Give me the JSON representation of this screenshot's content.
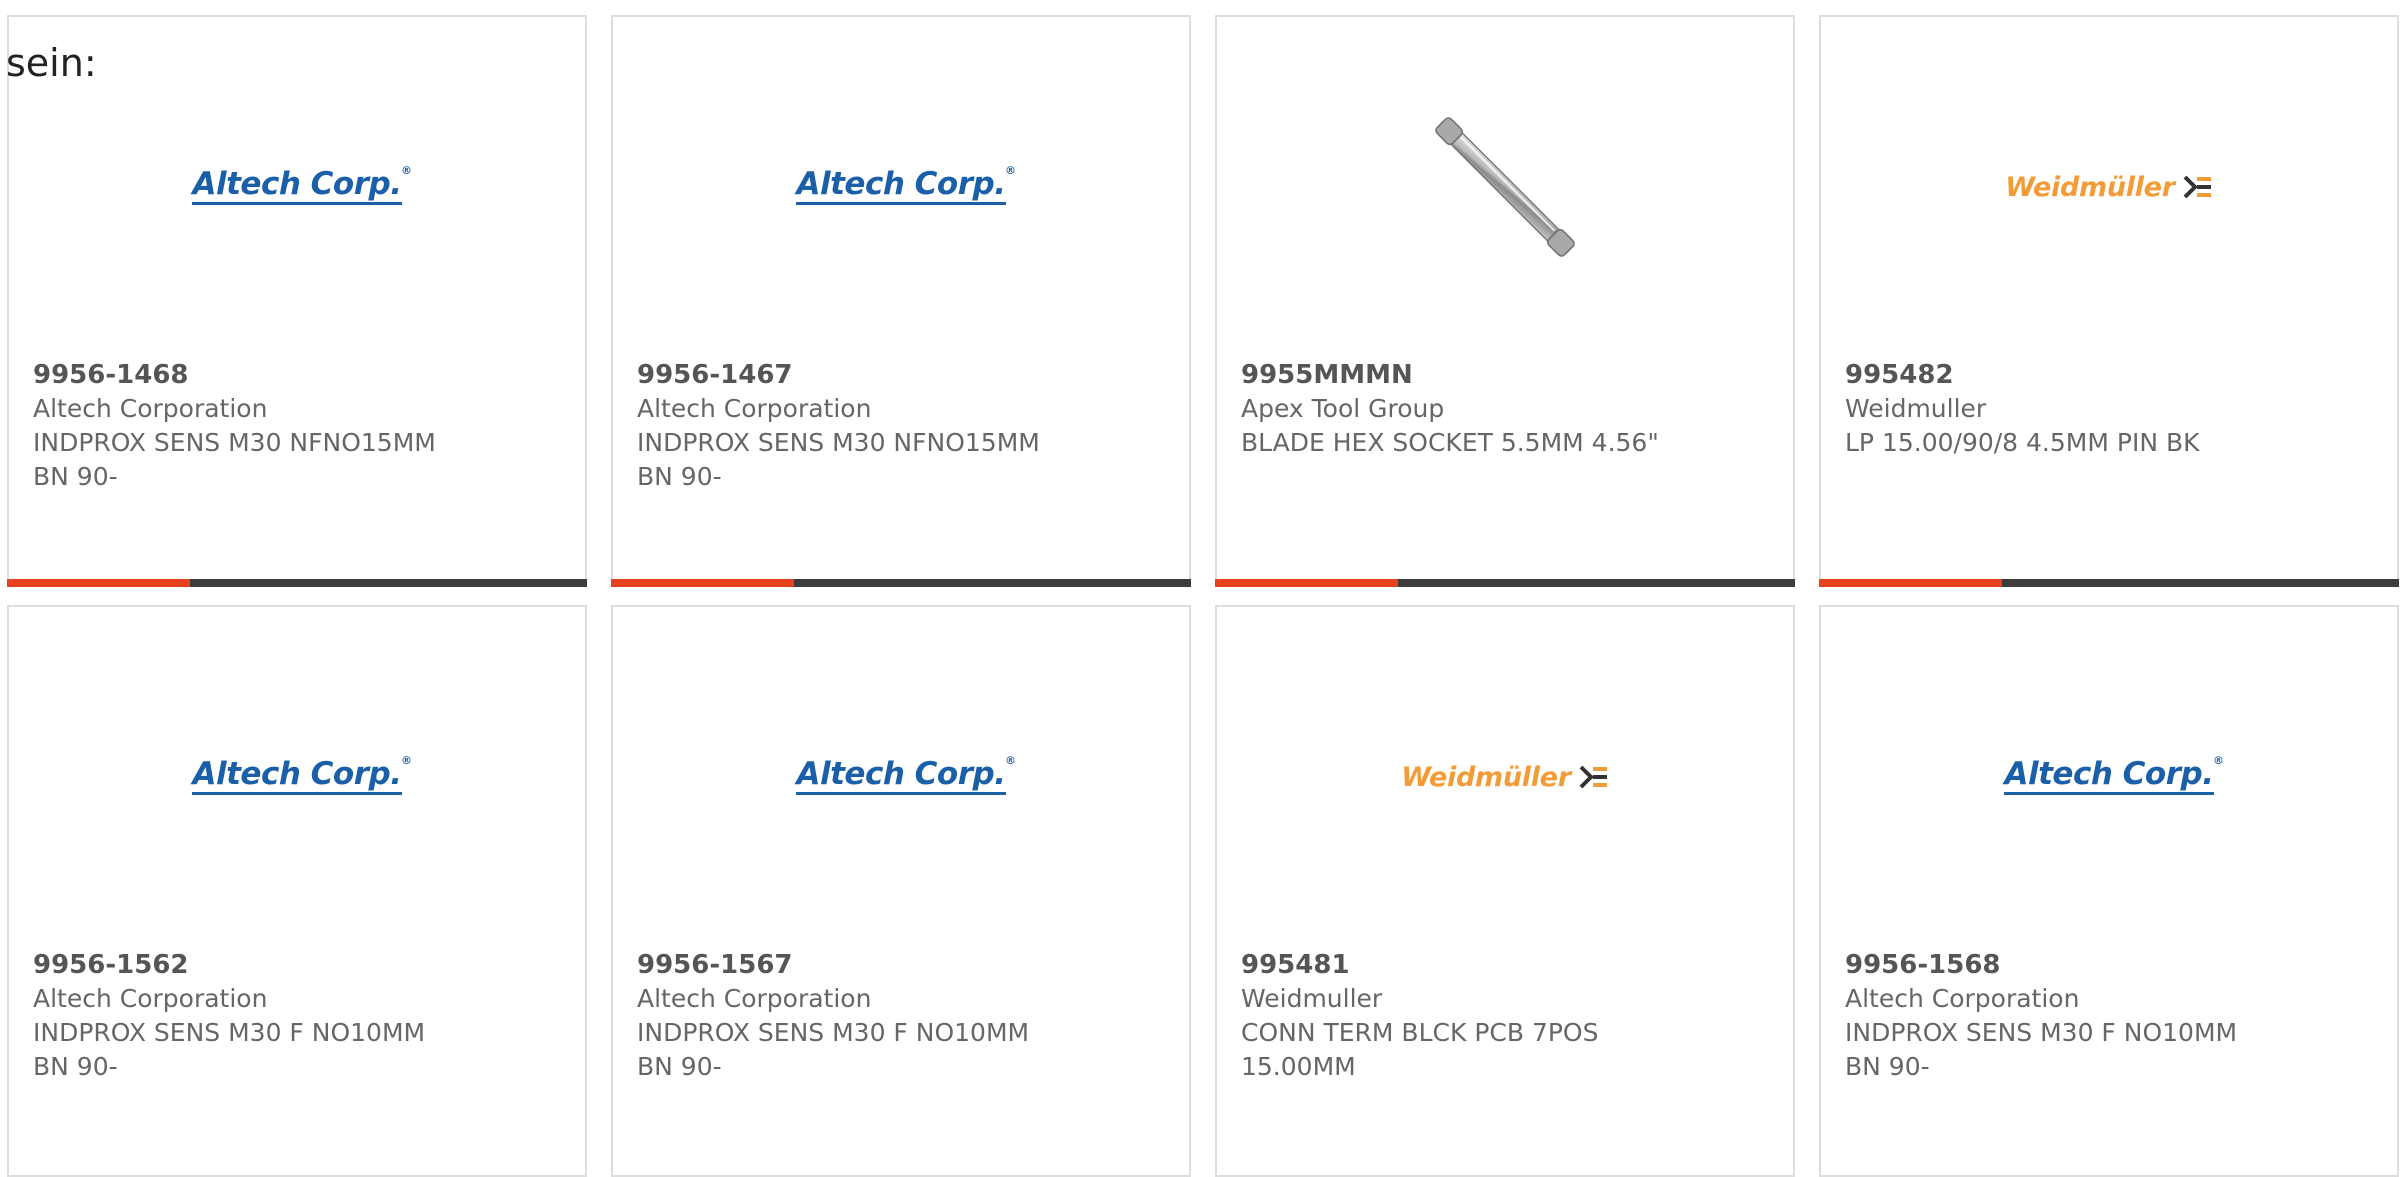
{
  "intro_text": "sein:",
  "colors": {
    "accent": "#e8411f",
    "bar": "#3d3d3d",
    "altech_blue": "#1a5fa8",
    "weidmuller_orange": "#f39c37"
  },
  "products": [
    {
      "part_number": "9956-1468",
      "manufacturer": "Altech Corporation",
      "description": "INDPROX SENS M30 NFNO15MM BN 90-",
      "image": "altech-logo",
      "logo_text": "Altech Corp."
    },
    {
      "part_number": "9956-1467",
      "manufacturer": "Altech Corporation",
      "description": "INDPROX SENS M30 NFNO15MM BN 90-",
      "image": "altech-logo",
      "logo_text": "Altech Corp."
    },
    {
      "part_number": "9955MMMN",
      "manufacturer": "Apex Tool Group",
      "description": "BLADE HEX SOCKET 5.5MM 4.56\"",
      "image": "hex-socket-blade-photo"
    },
    {
      "part_number": "995482",
      "manufacturer": "Weidmuller",
      "description": "LP 15.00/90/8 4.5MM PIN BK",
      "image": "weidmuller-logo",
      "logo_text": "Weidmüller"
    },
    {
      "part_number": "9956-1562",
      "manufacturer": "Altech Corporation",
      "description": "INDPROX SENS M30 F NO10MM BN 90-",
      "image": "altech-logo",
      "logo_text": "Altech Corp."
    },
    {
      "part_number": "9956-1567",
      "manufacturer": "Altech Corporation",
      "description": "INDPROX SENS M30 F NO10MM BN 90-",
      "image": "altech-logo",
      "logo_text": "Altech Corp."
    },
    {
      "part_number": "995481",
      "manufacturer": "Weidmuller",
      "description": "CONN TERM BLCK PCB 7POS 15.00MM",
      "image": "weidmuller-logo",
      "logo_text": "Weidmüller"
    },
    {
      "part_number": "9956-1568",
      "manufacturer": "Altech Corporation",
      "description": "INDPROX SENS M30 F NO10MM BN 90-",
      "image": "altech-logo",
      "logo_text": "Altech Corp."
    }
  ]
}
